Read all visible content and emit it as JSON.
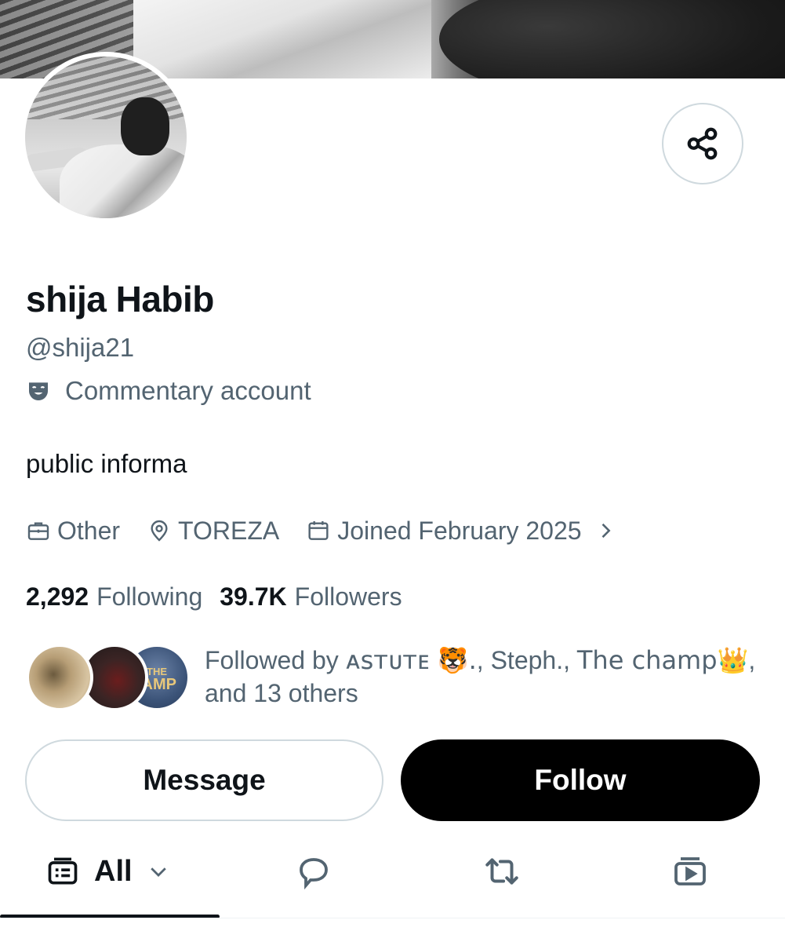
{
  "profile": {
    "display_name": "shija Habib",
    "handle": "@shija21",
    "label": "Commentary account",
    "bio": "public informa"
  },
  "meta": {
    "category": "Other",
    "location": "TOREZA",
    "joined": "Joined February 2025"
  },
  "stats": {
    "following_count": "2,292",
    "following_label": "Following",
    "followers_count": "39.7K",
    "followers_label": "Followers"
  },
  "followed_by": {
    "prefix": "Followed by ",
    "name1": "ᴀsᴛᴜᴛᴇ 🐯.",
    "sep1": ", ",
    "name2": "Steph.",
    "sep2": ", ",
    "name3": "The champ👑",
    "suffix": ", and 13 others",
    "avatar3_text_top": "THE",
    "avatar3_text_bottom": "IAMP"
  },
  "actions": {
    "message_label": "Message",
    "follow_label": "Follow"
  },
  "tabs": {
    "all_label": "All"
  },
  "colors": {
    "text_primary": "#0f1419",
    "text_secondary": "#536471",
    "border": "#cfd9de",
    "follow_bg": "#000000"
  },
  "icons": [
    "share-icon",
    "theater-mask-icon",
    "briefcase-icon",
    "location-pin-icon",
    "calendar-icon",
    "chevron-right-icon",
    "all-posts-icon",
    "chevron-down-icon",
    "reply-icon",
    "repost-icon",
    "video-icon"
  ]
}
